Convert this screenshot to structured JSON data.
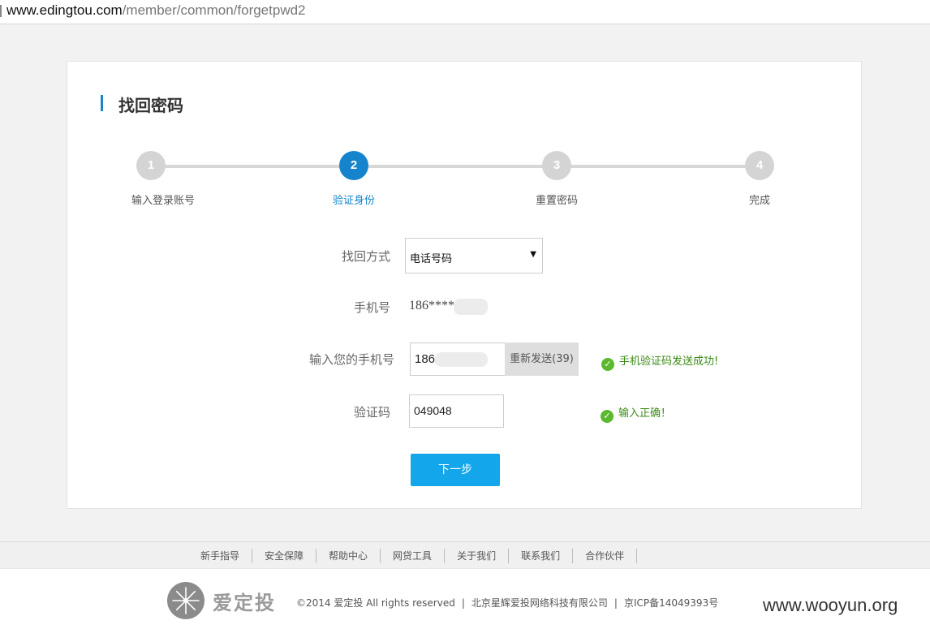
{
  "browser": {
    "url_host": "www.edingtou.com",
    "url_path": "/member/common/forgetpwd2"
  },
  "page": {
    "title": "找回密码"
  },
  "steps": [
    {
      "num": "1",
      "label": "输入登录账号",
      "active": false
    },
    {
      "num": "2",
      "label": "验证身份",
      "active": true
    },
    {
      "num": "3",
      "label": "重置密码",
      "active": false
    },
    {
      "num": "4",
      "label": "完成",
      "active": false
    }
  ],
  "form": {
    "method_label": "找回方式",
    "method_value": "电话号码",
    "phone_label": "手机号",
    "phone_value": "186****",
    "input_phone_label": "输入您的手机号",
    "input_phone_value": "186",
    "resend_label": "重新发送(39)",
    "sms_success": "手机验证码发送成功!",
    "code_label": "验证码",
    "code_value": "049048",
    "code_ok": "输入正确！",
    "next_label": "下一步"
  },
  "footer": {
    "links": [
      "新手指导",
      "安全保障",
      "帮助中心",
      "网贷工具",
      "关于我们",
      "联系我们",
      "合作伙伴"
    ],
    "logo_text": "爱定投",
    "copyright": "©2014 爱定投 All rights reserved",
    "company": "北京星辉爱投网络科技有限公司",
    "icp": "京ICP备14049393号"
  },
  "watermark": "www.wooyun.org",
  "colors": {
    "accent": "#1584cc",
    "button": "#13a6ea",
    "success": "#3b8a16"
  }
}
